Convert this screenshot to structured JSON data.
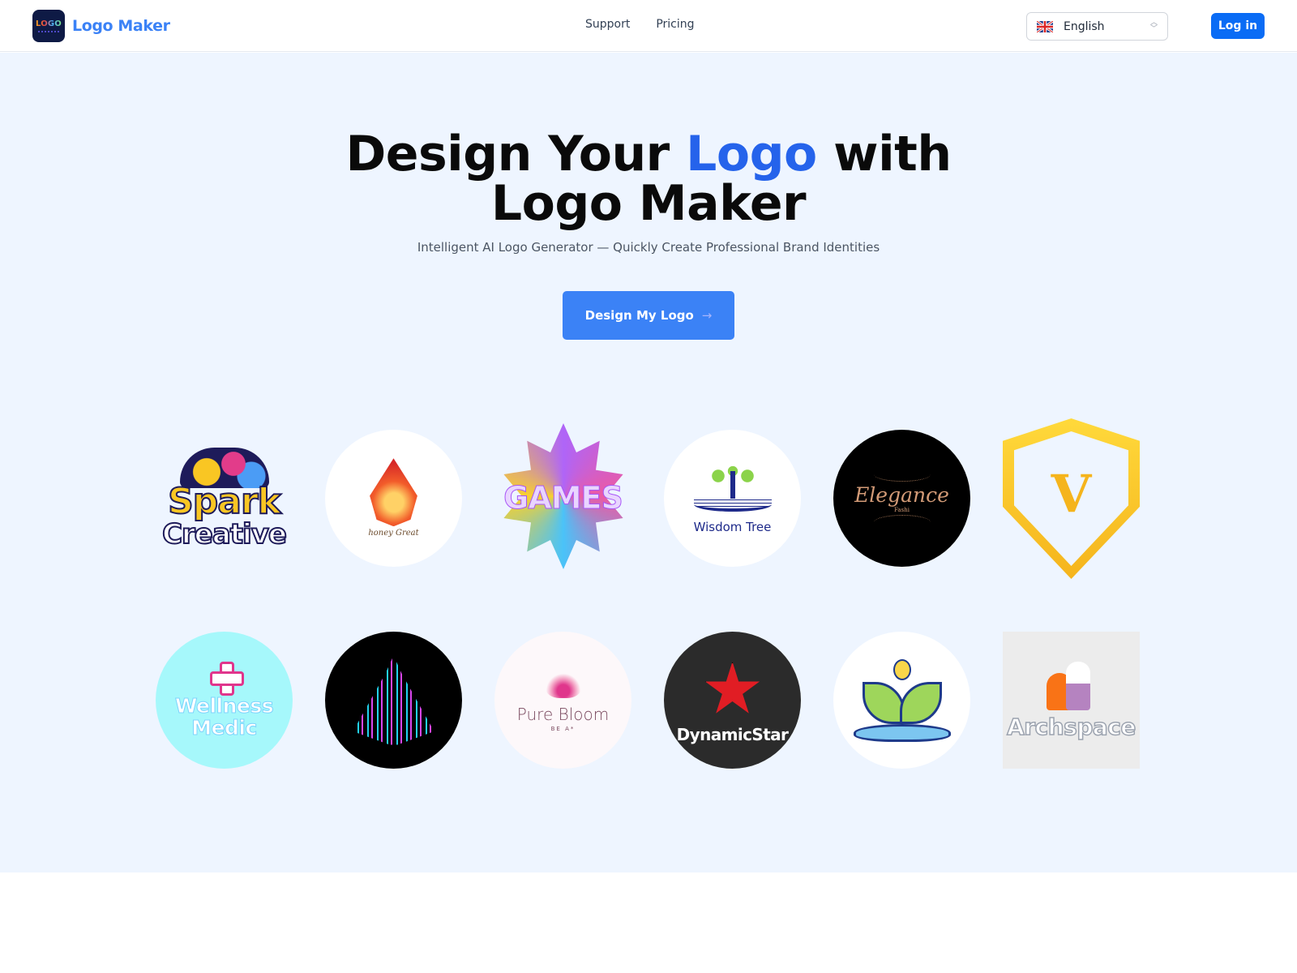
{
  "header": {
    "brand": {
      "icon_text": "LOGO",
      "name": "Logo Maker"
    },
    "nav": [
      {
        "label": "Support"
      },
      {
        "label": "Pricing"
      }
    ],
    "language": {
      "selected": "English",
      "flag": "uk-flag-icon"
    },
    "login_label": "Log in"
  },
  "hero": {
    "title_part1": "Design Your ",
    "title_accent": "Logo",
    "title_part2": " with",
    "title_line2": "Logo Maker",
    "subtitle": "Intelligent AI Logo Generator — Quickly Create Professional Brand Identities",
    "cta_label": "Design My Logo",
    "cta_icon": "→"
  },
  "gallery": {
    "row1": [
      {
        "name": "Spark Creative",
        "line1": "Spark",
        "line2": "Creative"
      },
      {
        "name": "honey Great",
        "line1": "honey  Great"
      },
      {
        "name": "GAMES",
        "line1": "GAMES"
      },
      {
        "name": "Wisdom Tree",
        "line1": "Wisdom Tree"
      },
      {
        "name": "Elegance",
        "line1": "Elegance",
        "line2": "Fashi"
      },
      {
        "name": "V Shield",
        "line1": "V"
      }
    ],
    "row2": [
      {
        "name": "Wellness Medic",
        "line1": "Wellness",
        "line2": "Medic"
      },
      {
        "name": "Neon Lines",
        "line1": ""
      },
      {
        "name": "Pure Bloom",
        "line1": "Pure Bloom",
        "line2": "BE A*"
      },
      {
        "name": "DynamicStar",
        "line1": "DynamicStar"
      },
      {
        "name": "Eco Hand",
        "line1": ""
      },
      {
        "name": "Archspace",
        "line1": "Archspace"
      }
    ]
  },
  "colors": {
    "brand": "#3b82f6",
    "accent": "#2563eb",
    "login": "#0a6cf5",
    "hero_bg": "#eef5ff"
  }
}
